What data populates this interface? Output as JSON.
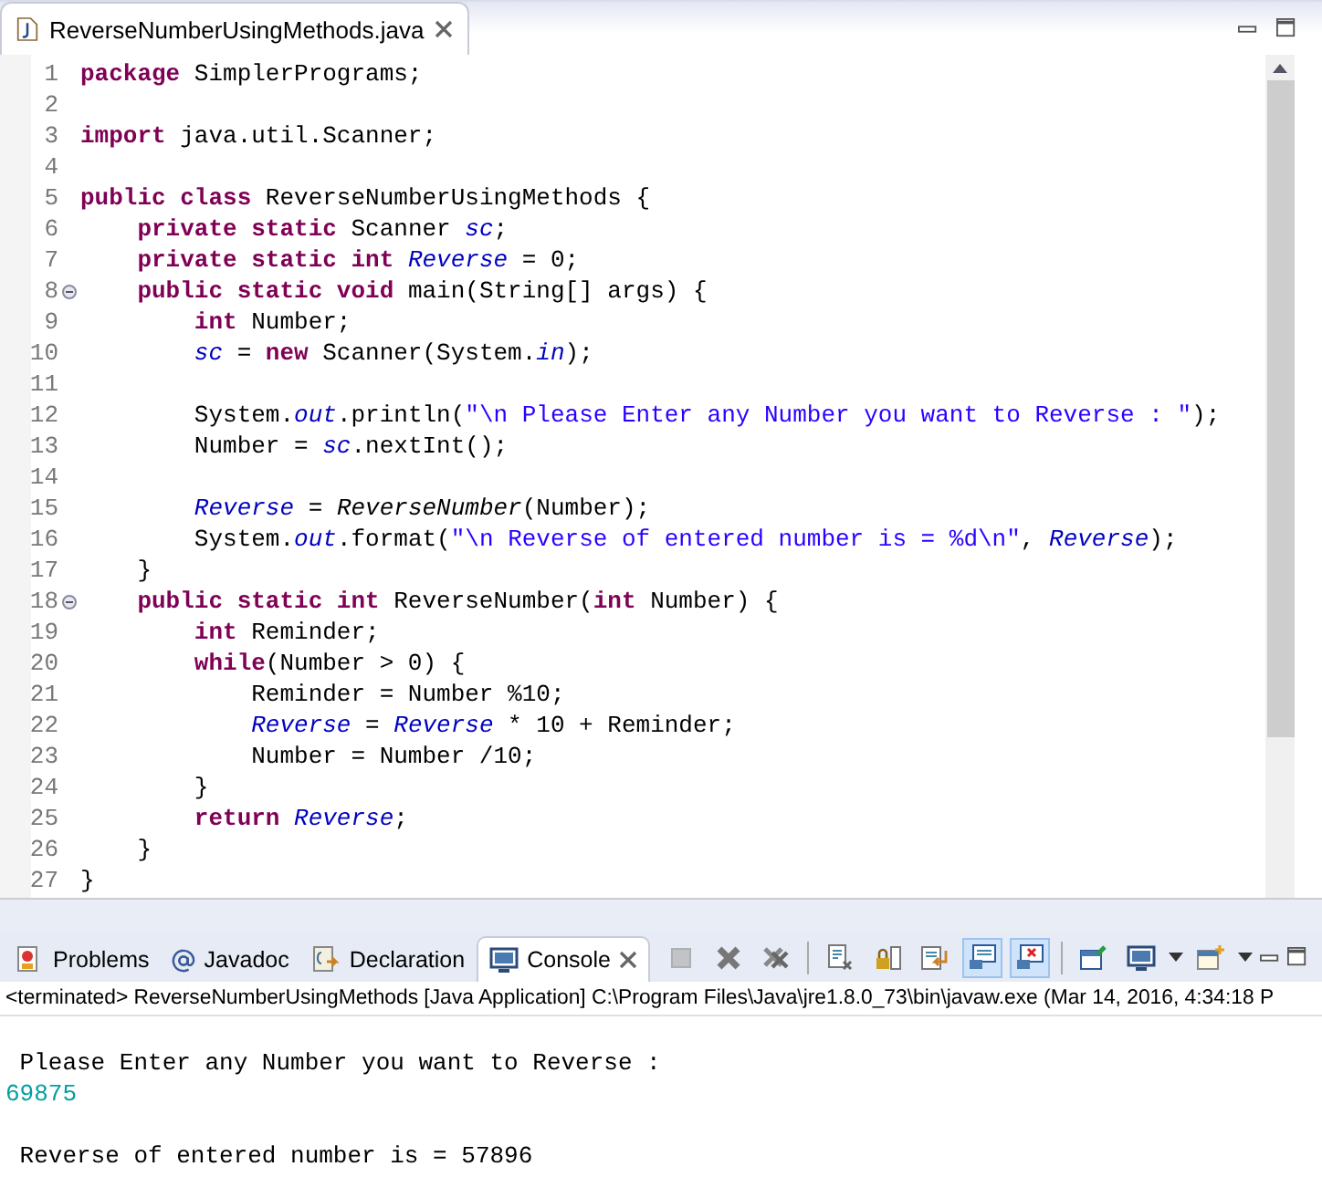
{
  "editor": {
    "tab": {
      "title": "ReverseNumberUsingMethods.java",
      "selected": true
    },
    "lines": [
      {
        "number": "1",
        "fold": false,
        "tokens": [
          {
            "kind": "keyword",
            "text": "package"
          },
          {
            "kind": "plain",
            "text": " SimplerPrograms;"
          }
        ]
      },
      {
        "number": "2",
        "fold": false
      },
      {
        "number": "3",
        "fold": false,
        "tokens": [
          {
            "kind": "keyword",
            "text": "import"
          },
          {
            "kind": "plain",
            "text": " java.util.Scanner;"
          }
        ]
      },
      {
        "number": "4",
        "fold": false
      },
      {
        "number": "5",
        "fold": false,
        "tokens": [
          {
            "kind": "keyword",
            "text": "public class"
          },
          {
            "kind": "plain",
            "text": " ReverseNumberUsingMethods {"
          }
        ]
      },
      {
        "number": "6",
        "fold": false,
        "tokens": [
          {
            "kind": "keyword",
            "text": "    private static"
          },
          {
            "kind": "plain",
            "text": " Scanner "
          },
          {
            "kind": "field",
            "text": "sc"
          },
          {
            "kind": "plain",
            "text": ";"
          }
        ]
      },
      {
        "number": "7",
        "fold": false,
        "tokens": [
          {
            "kind": "keyword",
            "text": "    private static int "
          },
          {
            "kind": "field",
            "text": "Reverse"
          },
          {
            "kind": "plain",
            "text": " = 0;"
          }
        ]
      },
      {
        "number": "8",
        "fold": true,
        "tokens": [
          {
            "kind": "keyword",
            "text": "    public static void"
          },
          {
            "kind": "plain",
            "text": " main(String[] args) {"
          }
        ]
      },
      {
        "number": "9",
        "fold": false,
        "tokens": [
          {
            "kind": "keyword",
            "text": "        int"
          },
          {
            "kind": "plain",
            "text": " Number;"
          }
        ]
      },
      {
        "number": "10",
        "fold": false,
        "tokens": [
          {
            "kind": "field",
            "text": "        sc"
          },
          {
            "kind": "plain",
            "text": " = "
          },
          {
            "kind": "keyword",
            "text": "new"
          },
          {
            "kind": "plain",
            "text": " Scanner(System."
          },
          {
            "kind": "field",
            "text": "in"
          },
          {
            "kind": "plain",
            "text": ");"
          }
        ]
      },
      {
        "number": "11",
        "fold": false
      },
      {
        "number": "12",
        "fold": false,
        "tokens": [
          {
            "kind": "plain",
            "text": "        System."
          },
          {
            "kind": "field",
            "text": "out"
          },
          {
            "kind": "plain",
            "text": ".println("
          },
          {
            "kind": "string",
            "text": "\"\\n Please Enter any Number you want to Reverse : \""
          },
          {
            "kind": "plain",
            "text": ");"
          }
        ]
      },
      {
        "number": "13",
        "fold": false,
        "tokens": [
          {
            "kind": "plain",
            "text": "        Number = "
          },
          {
            "kind": "field",
            "text": "sc"
          },
          {
            "kind": "plain",
            "text": ".nextInt();"
          }
        ]
      },
      {
        "number": "14",
        "fold": false
      },
      {
        "number": "15",
        "fold": false,
        "tokens": [
          {
            "kind": "field",
            "text": "        Reverse"
          },
          {
            "kind": "plain",
            "text": " = "
          },
          {
            "kind": "static_call",
            "text": "ReverseNumber"
          },
          {
            "kind": "plain",
            "text": "(Number);"
          }
        ]
      },
      {
        "number": "16",
        "fold": false,
        "tokens": [
          {
            "kind": "plain",
            "text": "        System."
          },
          {
            "kind": "field",
            "text": "out"
          },
          {
            "kind": "plain",
            "text": ".format("
          },
          {
            "kind": "string",
            "text": "\"\\n Reverse of entered number is = %d\\n\""
          },
          {
            "kind": "plain",
            "text": ", "
          },
          {
            "kind": "field",
            "text": "Reverse"
          },
          {
            "kind": "plain",
            "text": ");"
          }
        ]
      },
      {
        "number": "17",
        "fold": false,
        "tokens": [
          {
            "kind": "plain",
            "text": "    }"
          }
        ]
      },
      {
        "number": "18",
        "fold": true,
        "tokens": [
          {
            "kind": "keyword",
            "text": "    public static int"
          },
          {
            "kind": "plain",
            "text": " ReverseNumber("
          },
          {
            "kind": "keyword",
            "text": "int"
          },
          {
            "kind": "plain",
            "text": " Number) {"
          }
        ]
      },
      {
        "number": "19",
        "fold": false,
        "tokens": [
          {
            "kind": "keyword",
            "text": "        int"
          },
          {
            "kind": "plain",
            "text": " Reminder;"
          }
        ]
      },
      {
        "number": "20",
        "fold": false,
        "tokens": [
          {
            "kind": "keyword",
            "text": "        while"
          },
          {
            "kind": "plain",
            "text": "(Number > 0) {"
          }
        ]
      },
      {
        "number": "21",
        "fold": false,
        "tokens": [
          {
            "kind": "plain",
            "text": "            Reminder = Number %10;"
          }
        ]
      },
      {
        "number": "22",
        "fold": false,
        "tokens": [
          {
            "kind": "field",
            "text": "            Reverse"
          },
          {
            "kind": "plain",
            "text": " = "
          },
          {
            "kind": "field",
            "text": "Reverse"
          },
          {
            "kind": "plain",
            "text": " * 10 + Reminder;"
          }
        ]
      },
      {
        "number": "23",
        "fold": false,
        "tokens": [
          {
            "kind": "plain",
            "text": "            Number = Number /10;"
          }
        ]
      },
      {
        "number": "24",
        "fold": false,
        "tokens": [
          {
            "kind": "plain",
            "text": "        }"
          }
        ]
      },
      {
        "number": "25",
        "fold": false,
        "tokens": [
          {
            "kind": "keyword",
            "text": "        return "
          },
          {
            "kind": "field",
            "text": "Reverse"
          },
          {
            "kind": "plain",
            "text": ";"
          }
        ]
      },
      {
        "number": "26",
        "fold": false,
        "tokens": [
          {
            "kind": "plain",
            "text": "    }"
          }
        ]
      },
      {
        "number": "27",
        "fold": false,
        "tokens": [
          {
            "kind": "plain",
            "text": "}"
          }
        ]
      }
    ]
  },
  "bottom_panel": {
    "tabs": [
      {
        "label": "Problems",
        "selected": false,
        "closable": false
      },
      {
        "label": "Javadoc",
        "selected": false,
        "closable": false
      },
      {
        "label": "Declaration",
        "selected": false,
        "closable": false
      },
      {
        "label": "Console",
        "selected": true,
        "closable": true
      }
    ],
    "toolbar": [
      {
        "kind": "terminate",
        "disabled": true,
        "selected": false,
        "dropdown": false
      },
      {
        "kind": "remove",
        "disabled": false,
        "selected": false,
        "dropdown": false
      },
      {
        "kind": "remove_all",
        "disabled": false,
        "selected": false,
        "dropdown": false
      },
      {
        "kind": "separator"
      },
      {
        "kind": "clear",
        "disabled": false,
        "selected": false,
        "dropdown": false
      },
      {
        "kind": "scroll_lock",
        "disabled": false,
        "selected": false,
        "dropdown": false
      },
      {
        "kind": "word_wrap",
        "disabled": false,
        "selected": false,
        "dropdown": false
      },
      {
        "kind": "stdout",
        "disabled": false,
        "selected": true,
        "dropdown": false
      },
      {
        "kind": "stderr",
        "disabled": false,
        "selected": true,
        "dropdown": false
      },
      {
        "kind": "separator"
      },
      {
        "kind": "pin",
        "disabled": false,
        "selected": false,
        "dropdown": false
      },
      {
        "kind": "display",
        "disabled": false,
        "selected": false,
        "dropdown": true
      },
      {
        "kind": "open",
        "disabled": false,
        "selected": false,
        "dropdown": true
      }
    ],
    "console_header": "<terminated> ReverseNumberUsingMethods [Java Application] C:\\Program Files\\Java\\jre1.8.0_73\\bin\\javaw.exe (Mar 14, 2016, 4:34:18 P",
    "console_lines": [
      {
        "kind": "output",
        "text": " Please Enter any Number you want to Reverse : "
      },
      {
        "kind": "input",
        "text": "69875"
      },
      {
        "kind": "output",
        "text": " Reverse of entered number is = 57896"
      }
    ]
  }
}
